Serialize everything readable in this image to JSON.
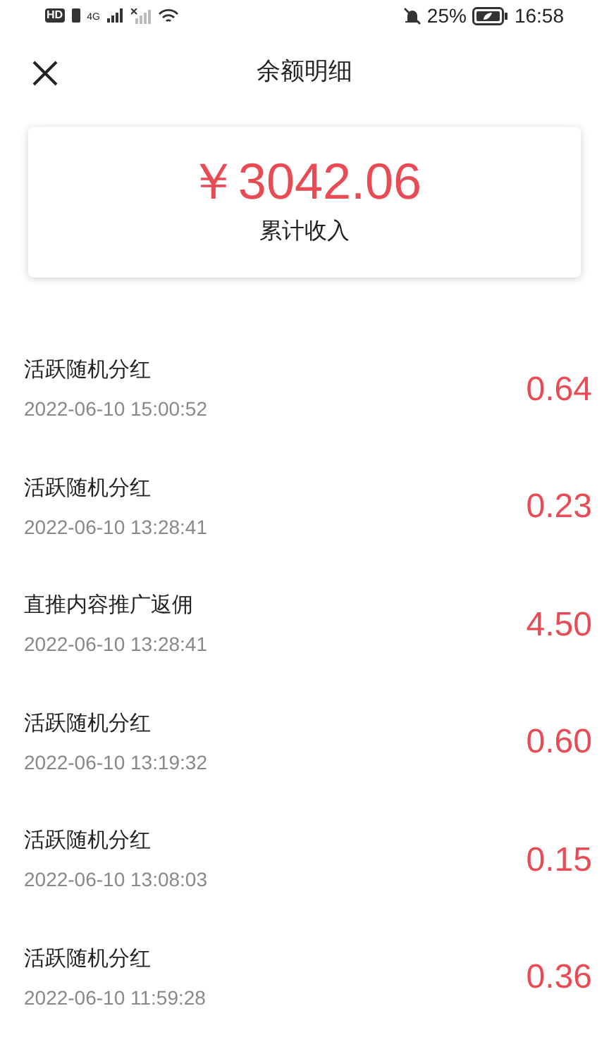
{
  "status_bar": {
    "hd_badge": "HD",
    "network": "4G",
    "battery": "25%",
    "time": "16:58"
  },
  "header": {
    "title": "余额明细"
  },
  "summary": {
    "amount": "￥3042.06",
    "label": "累计收入"
  },
  "records": [
    {
      "title": "活跃随机分红",
      "time": "2022-06-10 15:00:52",
      "amount": "0.64"
    },
    {
      "title": "活跃随机分红",
      "time": "2022-06-10 13:28:41",
      "amount": "0.23"
    },
    {
      "title": "直推内容推广返佣",
      "time": "2022-06-10 13:28:41",
      "amount": "4.50"
    },
    {
      "title": "活跃随机分红",
      "time": "2022-06-10 13:19:32",
      "amount": "0.60"
    },
    {
      "title": "活跃随机分红",
      "time": "2022-06-10 13:08:03",
      "amount": "0.15"
    },
    {
      "title": "活跃随机分红",
      "time": "2022-06-10 11:59:28",
      "amount": "0.36"
    }
  ]
}
